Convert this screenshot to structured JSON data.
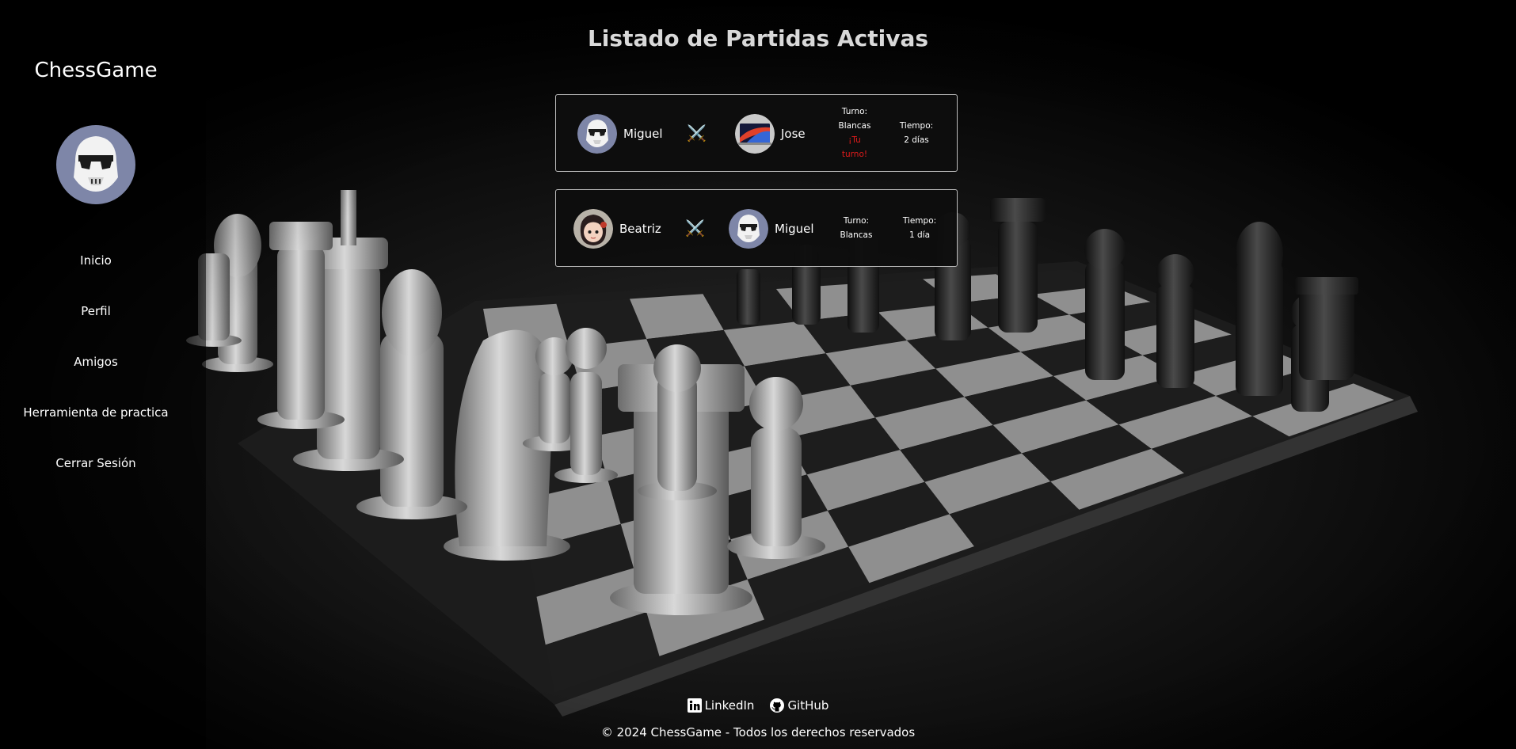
{
  "sidebar": {
    "brand": "ChessGame",
    "avatar_icon": "stormtrooper-avatar",
    "items": [
      {
        "label": "Inicio"
      },
      {
        "label": "Perfil"
      },
      {
        "label": "Amigos"
      },
      {
        "label": "Herramienta de practica"
      },
      {
        "label": "Cerrar Sesión"
      }
    ]
  },
  "main": {
    "title": "Listado de Partidas Activas",
    "games": [
      {
        "player1": {
          "name": "Miguel",
          "avatar": "stormtrooper-avatar"
        },
        "vs_icon": "crossed-swords-icon",
        "player2": {
          "name": "Jose",
          "avatar": "laptop-wallpaper-avatar"
        },
        "turn_label": "Turno:",
        "turn_value": "Blancas",
        "your_turn_line1": "¡Tu",
        "your_turn_line2": "turno!",
        "time_label": "Tiempo:",
        "time_value": "2 días"
      },
      {
        "player1": {
          "name": "Beatriz",
          "avatar": "anime-girl-avatar"
        },
        "vs_icon": "crossed-swords-icon",
        "player2": {
          "name": "Miguel",
          "avatar": "stormtrooper-avatar"
        },
        "turn_label": "Turno:",
        "turn_value": "Blancas",
        "time_label": "Tiempo:",
        "time_value": "1 día"
      }
    ]
  },
  "footer": {
    "links": [
      {
        "label": "LinkedIn",
        "icon": "linkedin-icon"
      },
      {
        "label": "GitHub",
        "icon": "github-icon"
      }
    ],
    "copyright": "© 2024 ChessGame - Todos los derechos reservados"
  },
  "colors": {
    "background": "#000000",
    "title": "#d9d9d9",
    "card_border": "#bdbdbd",
    "your_turn": "#e01b1b",
    "avatar_bg": "#7e86a8"
  }
}
